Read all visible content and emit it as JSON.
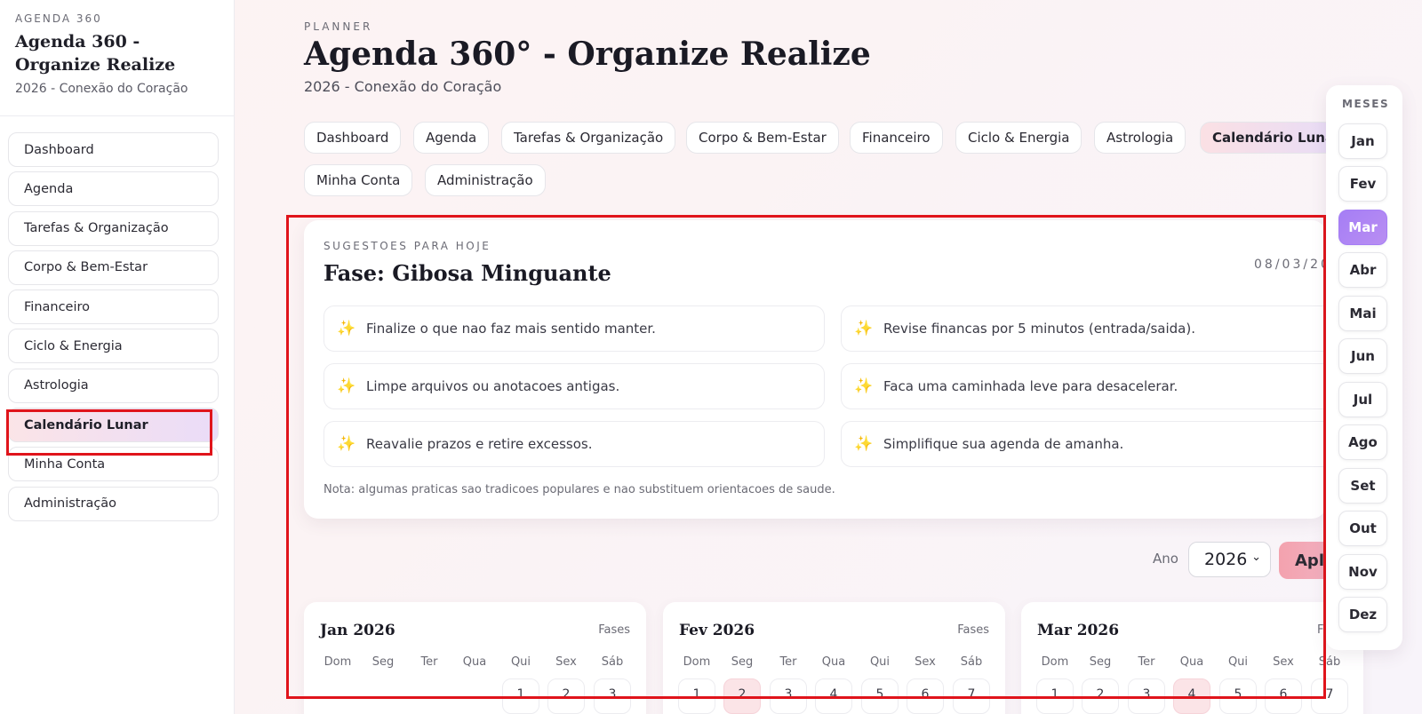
{
  "sidebar": {
    "kicker": "AGENDA 360",
    "title": "Agenda 360 - Organize Realize",
    "subtitle": "2026 - Conexão do Coração",
    "items": [
      {
        "label": "Dashboard"
      },
      {
        "label": "Agenda"
      },
      {
        "label": "Tarefas & Organização"
      },
      {
        "label": "Corpo & Bem-Estar"
      },
      {
        "label": "Financeiro"
      },
      {
        "label": "Ciclo & Energia"
      },
      {
        "label": "Astrologia"
      },
      {
        "label": "Calendário Lunar"
      },
      {
        "label": "Minha Conta"
      },
      {
        "label": "Administração"
      }
    ],
    "active_index": 7
  },
  "header": {
    "kicker": "PLANNER",
    "title": "Agenda 360° - Organize Realize",
    "subtitle": "2026 - Conexão do Coração"
  },
  "tabs": [
    {
      "label": "Dashboard"
    },
    {
      "label": "Agenda"
    },
    {
      "label": "Tarefas & Organização"
    },
    {
      "label": "Corpo & Bem-Estar"
    },
    {
      "label": "Financeiro"
    },
    {
      "label": "Ciclo & Energia"
    },
    {
      "label": "Astrologia"
    },
    {
      "label": "Calendário Lunar"
    },
    {
      "label": "Minha Conta"
    },
    {
      "label": "Administração"
    }
  ],
  "suggestions": {
    "kicker": "SUGESTOES PARA HOJE",
    "title": "Fase: Gibosa Minguante",
    "date": "08/03/20",
    "items": [
      "Finalize o que nao faz mais sentido manter.",
      "Revise financas por 5 minutos (entrada/saida).",
      "Limpe arquivos ou anotacoes antigas.",
      "Faca uma caminhada leve para desacelerar.",
      "Reavalie prazos e retire excessos.",
      "Simplifique sua agenda de amanha."
    ],
    "icon": "sparkles-icon",
    "note": "Nota: algumas praticas sao tradicoes populares e nao substituem orientacoes de saude."
  },
  "year": {
    "label": "Ano",
    "value": "2026",
    "apply_label": "Apli"
  },
  "weekdays": [
    "Dom",
    "Seg",
    "Ter",
    "Qua",
    "Qui",
    "Sex",
    "Sáb"
  ],
  "months": [
    {
      "title": "Jan 2026",
      "fases": "Fases",
      "first_row": [
        "",
        "",
        "",
        "",
        "1",
        "2",
        "3"
      ]
    },
    {
      "title": "Fev 2026",
      "fases": "Fases",
      "first_row": [
        "1",
        "2",
        "3",
        "4",
        "5",
        "6",
        "7"
      ]
    },
    {
      "title": "Mar 2026",
      "fases": "F",
      "first_row": [
        "1",
        "2",
        "3",
        "4",
        "5",
        "6",
        "7"
      ]
    }
  ],
  "month_rail": {
    "label": "MESES",
    "items": [
      "Jan",
      "Fev",
      "Mar",
      "Abr",
      "Mai",
      "Jun",
      "Jul",
      "Ago",
      "Set",
      "Out",
      "Nov",
      "Dez"
    ],
    "active": "Mar"
  },
  "colors": {
    "accent_purple": "#a57ef5",
    "accent_pink": "#f3a2ae",
    "highlight_red": "#e0141b"
  }
}
